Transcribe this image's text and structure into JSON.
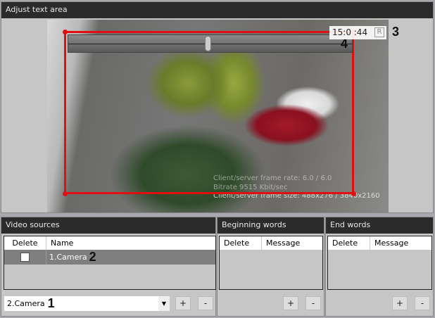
{
  "adjust_panel": {
    "title": "Adjust text area",
    "timestamp": "15:0 :44",
    "r_button": "R",
    "overlay_info": [
      "Client/server frame rate: 6.0 / 6.0",
      "Bitrate 9515 Kbit/sec",
      "Client/server frame size: 488x276 / 3840x2160"
    ],
    "slider_position": 0.49
  },
  "annotations": {
    "a1": "1",
    "a2": "2",
    "a3": "3",
    "a4": "4"
  },
  "video_sources": {
    "title": "Video sources",
    "columns": [
      "Delete",
      "Name"
    ],
    "rows": [
      {
        "delete": false,
        "name": "1.Camera"
      }
    ],
    "select_value": "2.Camera",
    "add": "+",
    "remove": "-"
  },
  "beginning_words": {
    "title": "Beginning words",
    "columns": [
      "Delete",
      "Message"
    ],
    "add": "+",
    "remove": "-"
  },
  "end_words": {
    "title": "End words",
    "columns": [
      "Delete",
      "Message"
    ],
    "add": "+",
    "remove": "-"
  }
}
